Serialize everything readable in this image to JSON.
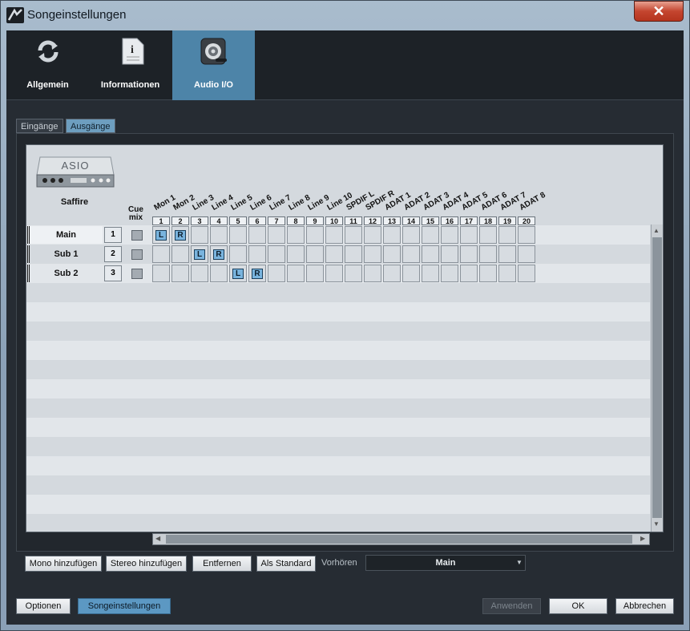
{
  "window": {
    "title": "Songeinstellungen",
    "close_symbol": "✕"
  },
  "top_tabs": [
    {
      "label": "Allgemein",
      "icon": "refresh-icon"
    },
    {
      "label": "Informationen",
      "icon": "info-document-icon"
    },
    {
      "label": "Audio I/O",
      "icon": "speaker-microphone-icon",
      "active": true
    }
  ],
  "sub_tabs": [
    {
      "label": "Eingänge"
    },
    {
      "label": "Ausgänge",
      "active": true
    }
  ],
  "device": {
    "logo_text": "ASIO",
    "name": "Saffire"
  },
  "cue_mix_label_1": "Cue",
  "cue_mix_label_2": "mix",
  "columns": [
    {
      "name": "Mon 1",
      "num": "1"
    },
    {
      "name": "Mon 2",
      "num": "2"
    },
    {
      "name": "Line 3",
      "num": "3"
    },
    {
      "name": "Line 4",
      "num": "4"
    },
    {
      "name": "Line 5",
      "num": "5"
    },
    {
      "name": "Line 6",
      "num": "6"
    },
    {
      "name": "Line 7",
      "num": "7"
    },
    {
      "name": "Line 8",
      "num": "8"
    },
    {
      "name": "Line 9",
      "num": "9"
    },
    {
      "name": "Line 10",
      "num": "10"
    },
    {
      "name": "SPDIF L",
      "num": "11"
    },
    {
      "name": "SPDIF R",
      "num": "12"
    },
    {
      "name": "ADAT 1",
      "num": "13"
    },
    {
      "name": "ADAT 2",
      "num": "14"
    },
    {
      "name": "ADAT 3",
      "num": "15"
    },
    {
      "name": "ADAT 4",
      "num": "16"
    },
    {
      "name": "ADAT 5",
      "num": "17"
    },
    {
      "name": "ADAT 6",
      "num": "18"
    },
    {
      "name": "ADAT 7",
      "num": "19"
    },
    {
      "name": "ADAT 8",
      "num": "20"
    }
  ],
  "rows": [
    {
      "label": "Main",
      "num": "1",
      "assign": {
        "0": "L",
        "1": "R"
      }
    },
    {
      "label": "Sub 1",
      "num": "2",
      "assign": {
        "2": "L",
        "3": "R"
      }
    },
    {
      "label": "Sub 2",
      "num": "3",
      "assign": {
        "4": "L",
        "5": "R"
      }
    }
  ],
  "buttons": {
    "mono": "Mono hinzufügen",
    "stereo": "Stereo hinzufügen",
    "remove": "Entfernen",
    "default": "Als Standard",
    "preview_label": "Vorhören",
    "preview_value": "Main",
    "options": "Optionen",
    "song_settings": "Songeinstellungen",
    "apply": "Anwenden",
    "ok": "OK",
    "cancel": "Abbrechen"
  }
}
